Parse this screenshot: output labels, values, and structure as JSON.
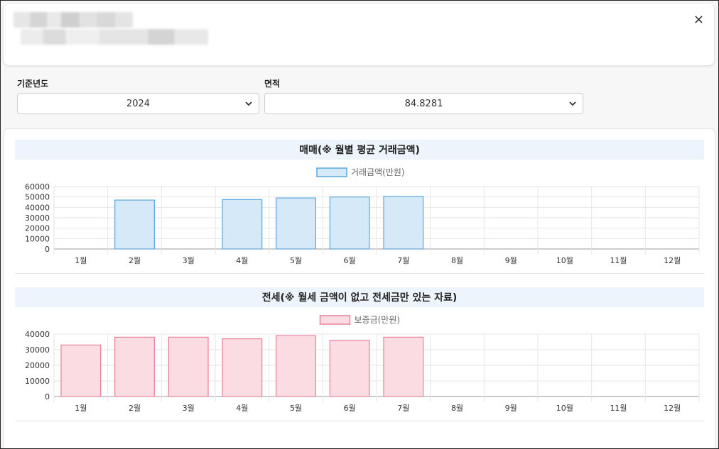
{
  "close_icon": "×",
  "filters": {
    "year_label": "기준년도",
    "year_value": "2024",
    "area_label": "면적",
    "area_value": "84.8281"
  },
  "chart_data": [
    {
      "type": "bar",
      "title": "매매(※ 월별 평균 거래금액)",
      "categories": [
        "1월",
        "2월",
        "3월",
        "4월",
        "5월",
        "6월",
        "7월",
        "8월",
        "9월",
        "10월",
        "11월",
        "12월"
      ],
      "series": [
        {
          "name": "거래금액(만원)",
          "values": [
            0,
            47000,
            0,
            47500,
            49000,
            50000,
            50500,
            0,
            0,
            0,
            0,
            0
          ]
        }
      ],
      "ylim": [
        0,
        60000
      ],
      "yticks": [
        "60000",
        "50000",
        "40000",
        "30000",
        "20000",
        "10000",
        "0"
      ],
      "fill": "#d6e9f8",
      "stroke": "#5ba7dd",
      "grid": true,
      "legend": "top"
    },
    {
      "type": "bar",
      "title": "전세(※ 월세 금액이 없고 전세금만 있는 자료)",
      "categories": [
        "1월",
        "2월",
        "3월",
        "4월",
        "5월",
        "6월",
        "7월",
        "8월",
        "9월",
        "10월",
        "11월",
        "12월"
      ],
      "series": [
        {
          "name": "보증금(만원)",
          "values": [
            33000,
            38000,
            38000,
            37000,
            39000,
            36000,
            38000,
            0,
            0,
            0,
            0,
            0
          ]
        }
      ],
      "ylim": [
        0,
        40000
      ],
      "yticks": [
        "40000",
        "30000",
        "20000",
        "10000",
        "0"
      ],
      "fill": "#fcdce3",
      "stroke": "#e8809a",
      "grid": true,
      "legend": "top"
    }
  ]
}
